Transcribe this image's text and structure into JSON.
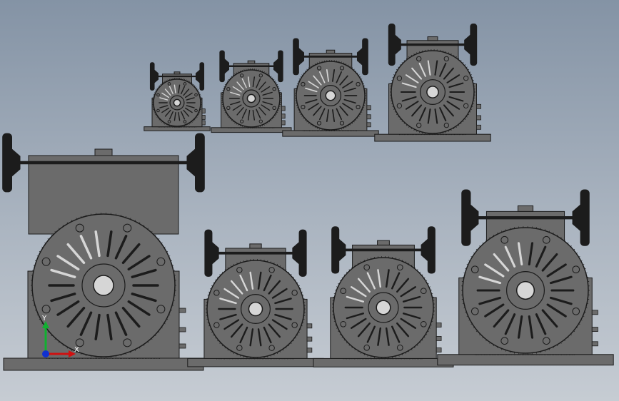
{
  "viewport": {
    "model_count": 8,
    "background_top": "#8493a5",
    "background_bottom": "#c6ccd3",
    "part_body_color": "#6b6b6b",
    "part_dark_color": "#1c1c1c",
    "part_highlight_color": "#d6d6d6"
  },
  "triad": {
    "x_label": "X",
    "y_label": "Y",
    "x_color": "#d01010",
    "y_color": "#10b030",
    "z_color": "#1030d0"
  }
}
